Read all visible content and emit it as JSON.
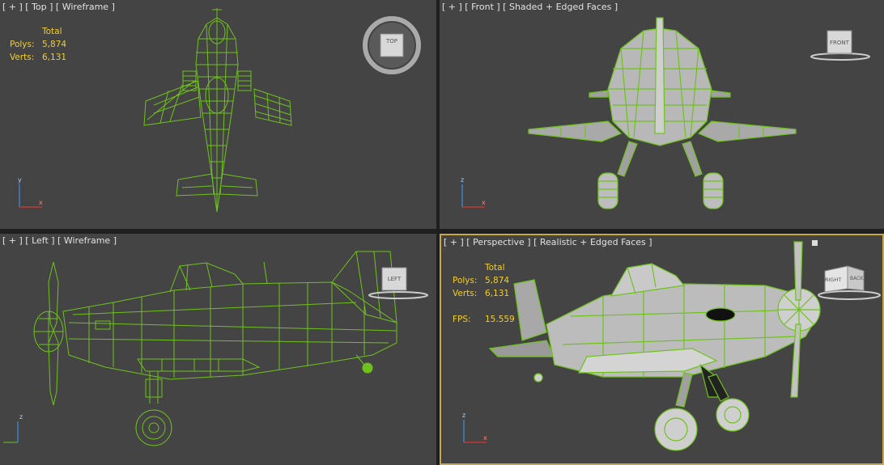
{
  "viewports": {
    "top": {
      "label": "[ + ] [ Top ] [ Wireframe ]",
      "cube": "TOP"
    },
    "front": {
      "label": "[ + ] [ Front ] [ Shaded + Edged Faces ]",
      "cube": "FRONT"
    },
    "left": {
      "label": "[ + ] [ Left ] [ Wireframe ]",
      "cube": "LEFT"
    },
    "persp": {
      "label": "[ + ] [ Perspective ] [ Realistic + Edged Faces ]",
      "cube_face1": "RIGHT",
      "cube_face2": "BACK"
    }
  },
  "stats_top": {
    "header": "Total",
    "polys_label": "Polys:",
    "polys": "5,874",
    "verts_label": "Verts:",
    "verts": "6,131"
  },
  "stats_persp": {
    "header": "Total",
    "polys_label": "Polys:",
    "polys": "5,874",
    "verts_label": "Verts:",
    "verts": "6,131",
    "fps_label": "FPS:",
    "fps": "15.559"
  },
  "axes": {
    "x": "x",
    "y": "y",
    "z": "z"
  },
  "colors": {
    "wire": "#6fc21c",
    "viewport_bg": "#444444",
    "stats": "#f2ce2a",
    "active_border": "#c8a64a"
  }
}
